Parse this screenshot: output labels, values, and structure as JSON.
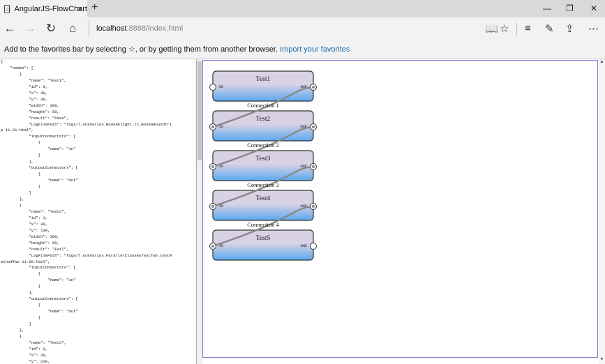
{
  "tab": {
    "title": "AngularJS-FlowChart",
    "close": "×",
    "new": "+"
  },
  "window": {
    "minimize": "—",
    "restore": "❐",
    "close": "✕"
  },
  "address": {
    "host": "localhost",
    "rest": ":8888/index.html"
  },
  "favorites_bar": {
    "message": "Add to the favorites bar by selecting ☆, or by getting them from another browser.",
    "link": "Import your favorites"
  },
  "json_text": "{\n    \"nodes\": [\n        {\n            \"name\": \"Test1\",\n            \"id\": 0,\n            \"x\": 30,\n            \"y\": 30,\n            \"width\": 300,\n            \"height\": 50,\n            \"result\": \"Pass\",\n            \"LogFilePath\": \"logs/T_scenarios.BookAFlight_TC_BookARoundTri\np 11-21.html\",\n            \"inputConnectors\": [\n                {\n                    \"name\": \"in\"\n                }\n            ],\n            \"outputConnectors\": [\n                {\n                    \"name\": \"out\"\n                }\n            ]\n        },\n        {\n            \"name\": \"Test2\",\n            \"id\": 1,\n            \"x\": 30,\n            \"y\": 130,\n            \"width\": 300,\n            \"height\": 50,\n            \"result\": \"Fail\",\n            \"LogFilePath\": \"logs/T_scenarios.ParallelClassesTestTwo_testM\nethodTwo 11-26.html\",\n            \"inputConnectors\": [\n                {\n                    \"name\": \"in\"\n                }\n            ],\n            \"outputConnectors\": [\n                {\n                    \"name\": \"out\"\n                }\n            ]\n        },\n        {\n            \"name\": \"Test3\",\n            \"id\": 2,\n            \"x\": 30,\n            \"y\": 230,\n            \"width\": 300,",
  "flowchart": {
    "nodes": [
      {
        "name": "Test1",
        "in": "in",
        "out": "out"
      },
      {
        "name": "Test2",
        "in": "in",
        "out": "out"
      },
      {
        "name": "Test3",
        "in": "in",
        "out": "out"
      },
      {
        "name": "Test4",
        "in": "in",
        "out": "out"
      },
      {
        "name": "Test5",
        "in": "in",
        "out": "out"
      }
    ],
    "connections": [
      "Connection 1",
      "Connection 2",
      "Connection 3",
      "Connection 4"
    ],
    "colors": {
      "node_top": "#d8d2e4",
      "node_bottom": "#5aa9f0",
      "curve": "#888888",
      "border": "#333333"
    }
  }
}
